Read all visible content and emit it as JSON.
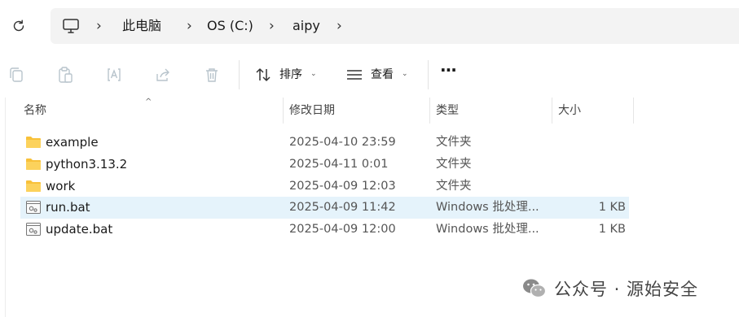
{
  "breadcrumb": {
    "items": [
      "此电脑",
      "OS (C:)",
      "aipy"
    ]
  },
  "toolbar": {
    "sort_label": "排序",
    "view_label": "查看",
    "more_label": "···"
  },
  "columns": {
    "name": "名称",
    "modified": "修改日期",
    "type": "类型",
    "size": "大小"
  },
  "files": [
    {
      "name": "example",
      "modified": "2025-04-10 23:59",
      "type": "文件夹",
      "size": "",
      "kind": "folder-icon",
      "selected": false
    },
    {
      "name": "python3.13.2",
      "modified": "2025-04-11 0:01",
      "type": "文件夹",
      "size": "",
      "kind": "folder-icon",
      "selected": false
    },
    {
      "name": "work",
      "modified": "2025-04-09 12:03",
      "type": "文件夹",
      "size": "",
      "kind": "folder-icon",
      "selected": false
    },
    {
      "name": "run.bat",
      "modified": "2025-04-09 11:42",
      "type": "Windows 批处理...",
      "size": "1 KB",
      "kind": "batch-file-icon",
      "selected": true
    },
    {
      "name": "update.bat",
      "modified": "2025-04-09 12:00",
      "type": "Windows 批处理...",
      "size": "1 KB",
      "kind": "batch-file-icon",
      "selected": false
    }
  ],
  "watermark": {
    "text": "公众号 · 源始安全"
  },
  "colors": {
    "folder": "#f8c13a",
    "selected_row": "#e5f3fb",
    "address_bg": "#f3f3f3"
  }
}
